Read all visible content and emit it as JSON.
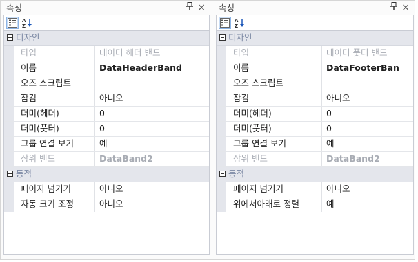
{
  "panels": [
    {
      "title": "속성",
      "pin_glyph": "⚲",
      "close_glyph": "×",
      "toolbar": {
        "categorized_icon": "categorized-icon",
        "alphabetical_icon": "sort-alphabetical-icon"
      },
      "sections": [
        {
          "label": "디자인",
          "rows": [
            {
              "name": "타입",
              "value": "데이터 헤더 밴드",
              "disabled": true
            },
            {
              "name": "이름",
              "value": "DataHeaderBand",
              "bold": true
            },
            {
              "name": "오즈 스크립트",
              "value": ""
            },
            {
              "name": "잠김",
              "value": "아니오"
            },
            {
              "name": "더미(헤더)",
              "value": "0"
            },
            {
              "name": "더미(풋터)",
              "value": "0"
            },
            {
              "name": "그룹 연결 보기",
              "value": "예"
            },
            {
              "name": "상위 밴드",
              "value": "DataBand2",
              "disabled": true,
              "bold": true
            }
          ]
        },
        {
          "label": "동적",
          "rows": [
            {
              "name": "페이지 넘기기",
              "value": "아니오"
            },
            {
              "name": "자동 크기 조정",
              "value": "아니오"
            }
          ]
        }
      ]
    },
    {
      "title": "속성",
      "pin_glyph": "⚲",
      "close_glyph": "×",
      "toolbar": {
        "categorized_icon": "categorized-icon",
        "alphabetical_icon": "sort-alphabetical-icon"
      },
      "sections": [
        {
          "label": "디자인",
          "rows": [
            {
              "name": "타입",
              "value": "데이터 풋터 밴드",
              "disabled": true
            },
            {
              "name": "이름",
              "value": "DataFooterBan",
              "bold": true
            },
            {
              "name": "오즈 스크립트",
              "value": ""
            },
            {
              "name": "잠김",
              "value": "아니오"
            },
            {
              "name": "더미(헤더)",
              "value": "0"
            },
            {
              "name": "더미(풋터)",
              "value": "0"
            },
            {
              "name": "그룹 연결 보기",
              "value": "예"
            },
            {
              "name": "상위 밴드",
              "value": "DataBand2",
              "disabled": true,
              "bold": true
            }
          ]
        },
        {
          "label": "동적",
          "rows": [
            {
              "name": "페이지 넘기기",
              "value": "아니오"
            },
            {
              "name": "위에서아래로 정렬",
              "value": "예"
            }
          ]
        }
      ]
    }
  ]
}
